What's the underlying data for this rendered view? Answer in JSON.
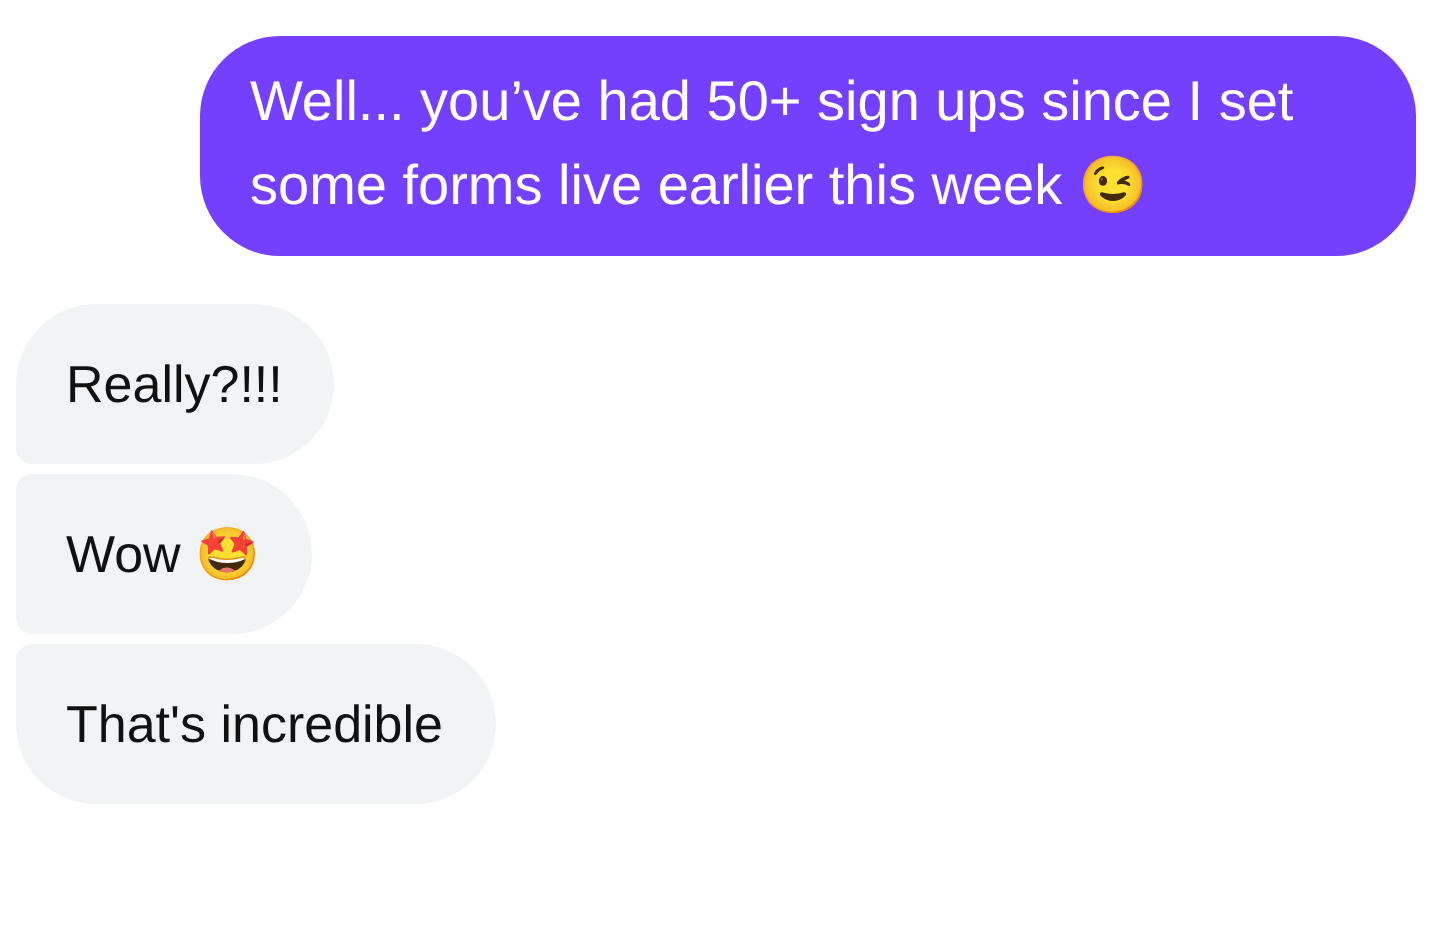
{
  "messages": [
    {
      "kind": "outgoing",
      "text": "Well... you’ve had 50+ sign ups since I set some forms live earlier this week 😉"
    },
    {
      "kind": "incoming",
      "text": "Really?!!!"
    },
    {
      "kind": "incoming",
      "text": "Wow 🤩"
    },
    {
      "kind": "incoming",
      "text": "That's incredible"
    }
  ]
}
